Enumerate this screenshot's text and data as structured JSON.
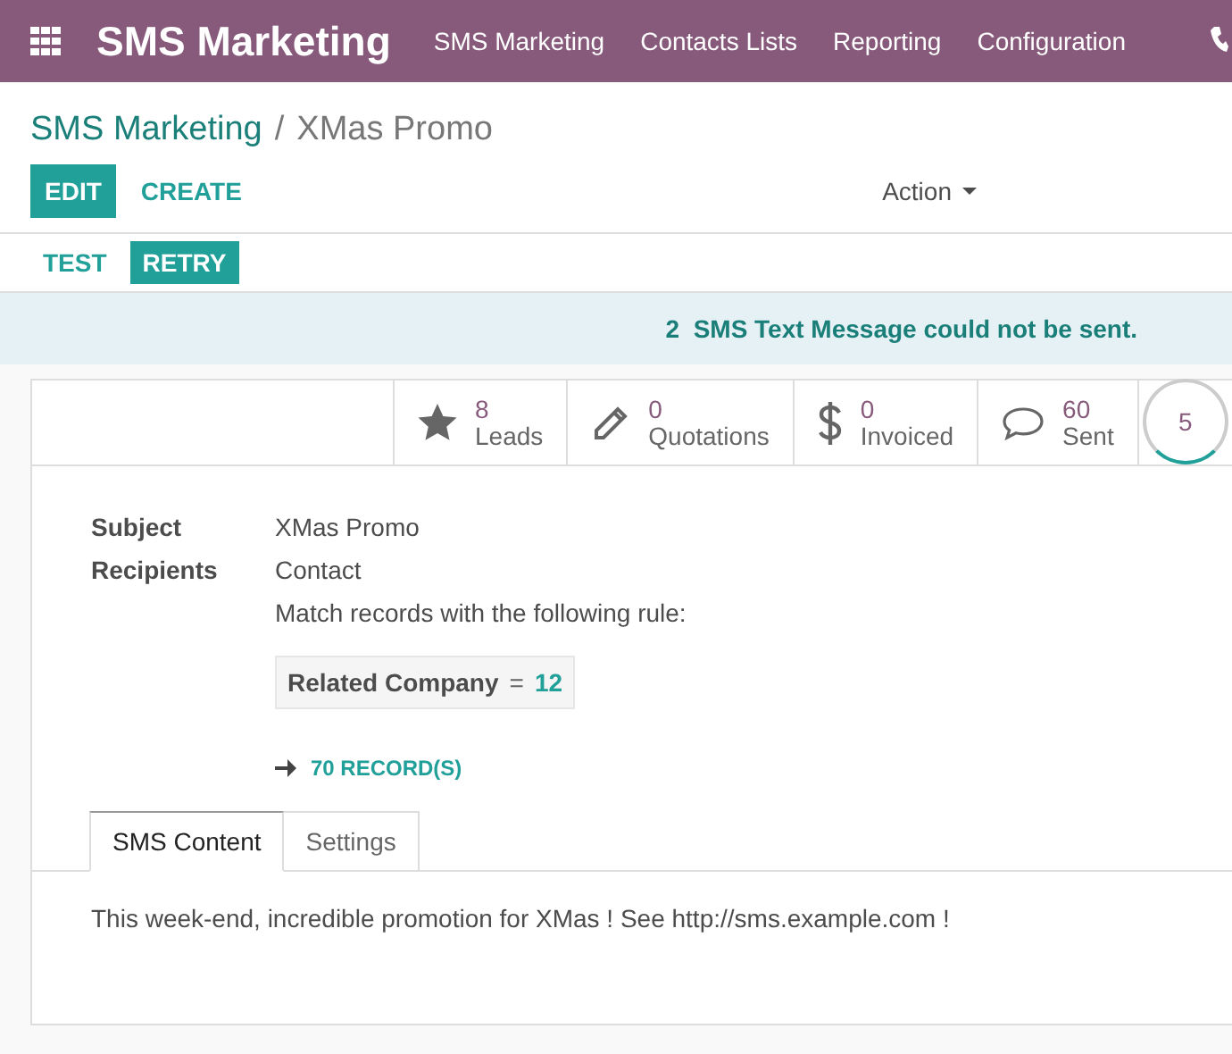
{
  "navbar": {
    "app_title": "SMS Marketing",
    "menu": [
      {
        "label": "SMS Marketing"
      },
      {
        "label": "Contacts Lists"
      },
      {
        "label": "Reporting"
      },
      {
        "label": "Configuration"
      }
    ]
  },
  "breadcrumb": [
    {
      "label": "SMS Marketing",
      "kind": "link"
    },
    {
      "label": "/",
      "kind": "separator"
    },
    {
      "label": "XMas Promo",
      "kind": "current"
    }
  ],
  "control_buttons": [
    {
      "label": "EDIT",
      "kind": "primary"
    },
    {
      "label": "CREATE",
      "kind": "link"
    }
  ],
  "action_menu": {
    "label": "Action"
  },
  "header_buttons": [
    {
      "label": "TEST",
      "kind": "link"
    },
    {
      "label": "RETRY",
      "kind": "primary"
    }
  ],
  "alert": {
    "count": "2",
    "message": "SMS Text Message could not be sent."
  },
  "stat_buttons": [
    {
      "kind": "star",
      "value": "8",
      "label": "Leads"
    },
    {
      "kind": "pencil",
      "value": "0",
      "label": "Quotations"
    },
    {
      "kind": "dollar",
      "value": "0",
      "label": "Invoiced"
    },
    {
      "kind": "comment",
      "value": "60",
      "label": "Sent"
    }
  ],
  "gauge": {
    "value": "5"
  },
  "fields": [
    {
      "label": "Subject",
      "value": "XMas Promo"
    },
    {
      "label": "Recipients",
      "value": "Contact"
    }
  ],
  "rule": {
    "intro": "Match records with the following rule:",
    "field": "Related Company",
    "operator": "=",
    "value": "12"
  },
  "records_link": {
    "label": "70 RECORD(S)"
  },
  "tabs": [
    {
      "label": "SMS Content",
      "selected": true
    },
    {
      "label": "Settings",
      "selected": false
    }
  ],
  "sms_body": "This week-end, incredible promotion for XMas ! See http://sms.example.com !"
}
